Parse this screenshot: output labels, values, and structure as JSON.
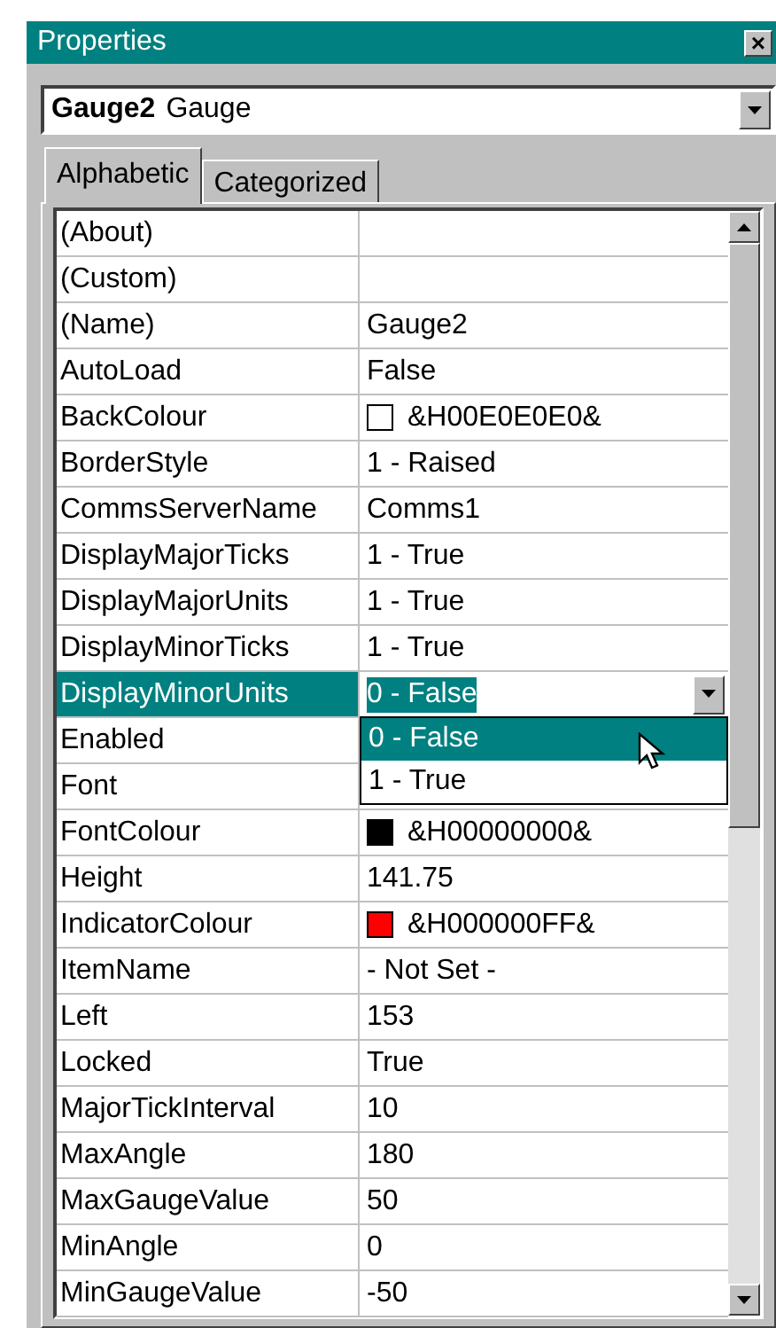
{
  "window": {
    "title": "Properties",
    "close": "×"
  },
  "object_selector": {
    "name": "Gauge2",
    "type": "Gauge"
  },
  "tabs": [
    {
      "label": "Alphabetic",
      "selected": true
    },
    {
      "label": "Categorized",
      "selected": false
    }
  ],
  "properties": [
    {
      "name": "(About)",
      "selected": false
    },
    {
      "name": "(Custom)",
      "selected": false
    },
    {
      "name": "(Name)",
      "value": "Gauge2",
      "selected": false
    },
    {
      "name": "AutoLoad",
      "value": "False",
      "selected": false
    },
    {
      "name": "BackColour",
      "value": "&H00E0E0E0&",
      "color": "#ffffff",
      "selected": false
    },
    {
      "name": "BorderStyle",
      "value": "1 - Raised",
      "selected": false
    },
    {
      "name": "CommsServerName",
      "value": "Comms1",
      "selected": false
    },
    {
      "name": "DisplayMajorTicks",
      "value": "1 - True",
      "selected": false
    },
    {
      "name": "DisplayMajorUnits",
      "value": "1 - True",
      "selected": false
    },
    {
      "name": "DisplayMinorTicks",
      "value": "1 - True",
      "selected": false
    },
    {
      "name": "DisplayMinorUnits",
      "value": "0 - False",
      "selected": true,
      "options": [
        {
          "label": "0 - False",
          "selected": true
        },
        {
          "label": "1 - True",
          "selected": false
        }
      ]
    },
    {
      "name": "Enabled",
      "selected": false
    },
    {
      "name": "Font",
      "selected": false
    },
    {
      "name": "FontColour",
      "value": "&H00000000&",
      "color": "#000000",
      "selected": false
    },
    {
      "name": "Height",
      "value": "141.75",
      "selected": false
    },
    {
      "name": "IndicatorColour",
      "value": "&H000000FF&",
      "color": "#ff0000",
      "selected": false
    },
    {
      "name": "ItemName",
      "value": "- Not Set -",
      "selected": false
    },
    {
      "name": "Left",
      "value": "153",
      "selected": false
    },
    {
      "name": "Locked",
      "value": "True",
      "selected": false
    },
    {
      "name": "MajorTickInterval",
      "value": "10",
      "selected": false
    },
    {
      "name": "MaxAngle",
      "value": "180",
      "selected": false
    },
    {
      "name": "MaxGaugeValue",
      "value": "50",
      "selected": false
    },
    {
      "name": "MinAngle",
      "value": "0",
      "selected": false
    },
    {
      "name": "MinGaugeValue",
      "value": "-50",
      "selected": false
    }
  ]
}
